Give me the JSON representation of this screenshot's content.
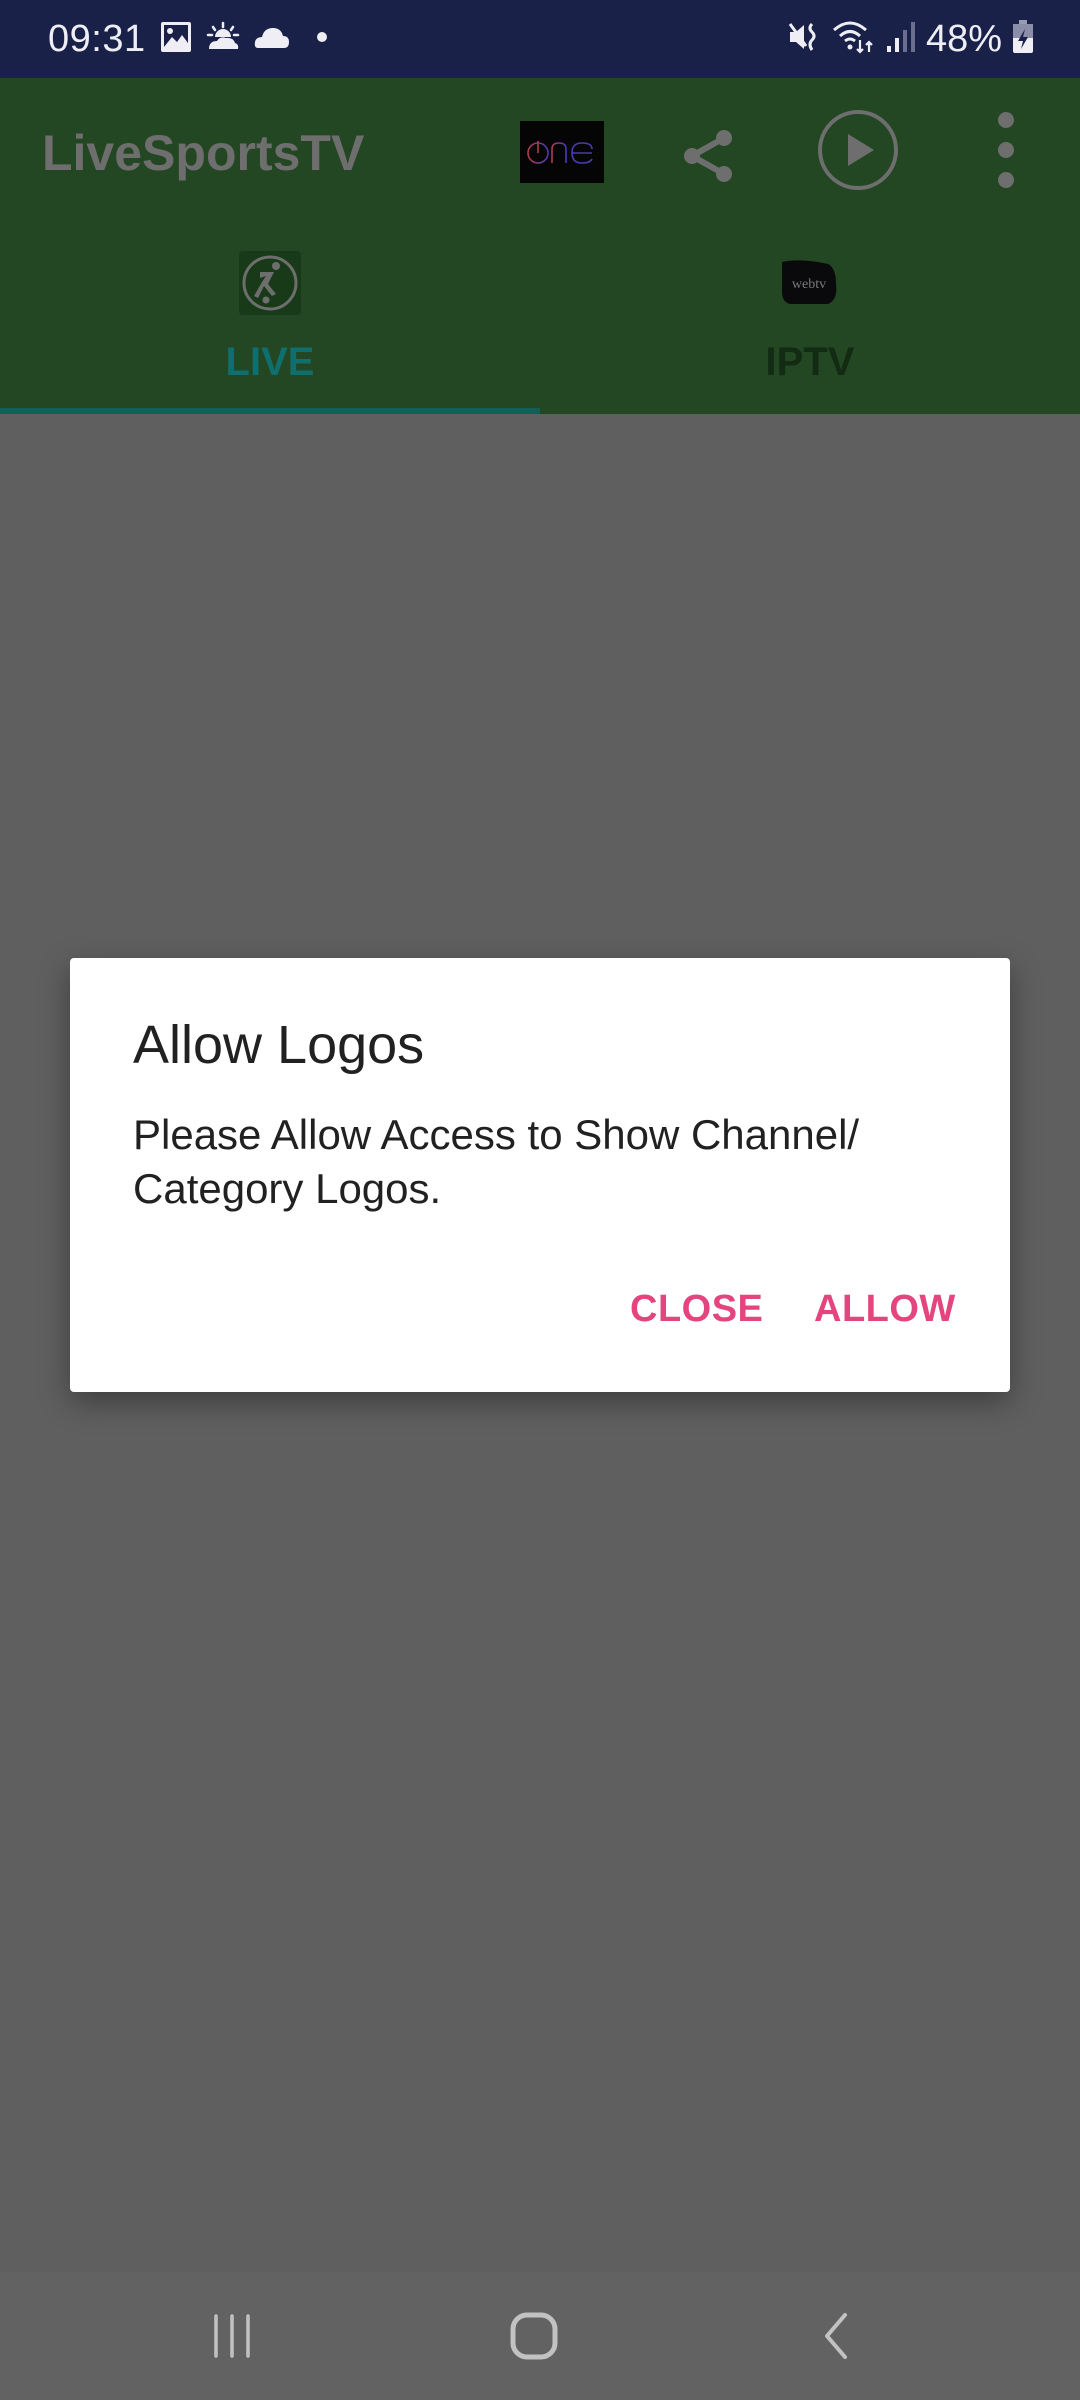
{
  "status_bar": {
    "time": "09:31",
    "left_icons": [
      "gallery-icon",
      "weather-sunrise-icon",
      "cloud-icon",
      "dot-icon"
    ],
    "right_icons": [
      "mute-vibrate-icon",
      "wifi-icon",
      "signal-icon",
      "battery-charging-icon"
    ],
    "battery_percent": "48%"
  },
  "app_bar": {
    "title": "LiveSportsTV",
    "channel_logo_text": "one",
    "actions": [
      "share-icon",
      "play-circle-icon",
      "more-vertical-icon"
    ]
  },
  "tabs": [
    {
      "label": "LIVE",
      "icon": "soccer-player-icon",
      "selected": true
    },
    {
      "label": "IPTV",
      "icon": "webtv-logo-icon",
      "selected": false,
      "icon_text": "webtv"
    }
  ],
  "dialog": {
    "title": "Allow Logos",
    "message": "Please Allow Access to Show Channel/ Category Logos.",
    "buttons": {
      "close": "CLOSE",
      "allow": "ALLOW"
    },
    "accent_color": "#e4457e"
  },
  "nav_bar": {
    "buttons": [
      "recent-apps-icon",
      "home-icon",
      "back-icon"
    ]
  },
  "colors": {
    "status_bar": "#1a2149",
    "app_bar_dimmed": "#224722",
    "tab_indicator": "#135e55",
    "scrim": "#5f5f5f"
  }
}
